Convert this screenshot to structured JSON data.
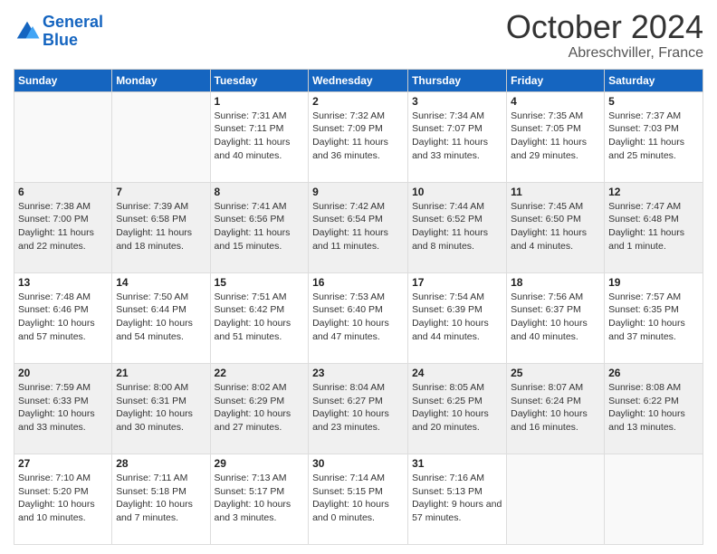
{
  "header": {
    "logo_line1": "General",
    "logo_line2": "Blue",
    "month": "October 2024",
    "location": "Abreschviller, France"
  },
  "days_of_week": [
    "Sunday",
    "Monday",
    "Tuesday",
    "Wednesday",
    "Thursday",
    "Friday",
    "Saturday"
  ],
  "weeks": [
    [
      {
        "day": "",
        "info": ""
      },
      {
        "day": "",
        "info": ""
      },
      {
        "day": "1",
        "info": "Sunrise: 7:31 AM\nSunset: 7:11 PM\nDaylight: 11 hours and 40 minutes."
      },
      {
        "day": "2",
        "info": "Sunrise: 7:32 AM\nSunset: 7:09 PM\nDaylight: 11 hours and 36 minutes."
      },
      {
        "day": "3",
        "info": "Sunrise: 7:34 AM\nSunset: 7:07 PM\nDaylight: 11 hours and 33 minutes."
      },
      {
        "day": "4",
        "info": "Sunrise: 7:35 AM\nSunset: 7:05 PM\nDaylight: 11 hours and 29 minutes."
      },
      {
        "day": "5",
        "info": "Sunrise: 7:37 AM\nSunset: 7:03 PM\nDaylight: 11 hours and 25 minutes."
      }
    ],
    [
      {
        "day": "6",
        "info": "Sunrise: 7:38 AM\nSunset: 7:00 PM\nDaylight: 11 hours and 22 minutes."
      },
      {
        "day": "7",
        "info": "Sunrise: 7:39 AM\nSunset: 6:58 PM\nDaylight: 11 hours and 18 minutes."
      },
      {
        "day": "8",
        "info": "Sunrise: 7:41 AM\nSunset: 6:56 PM\nDaylight: 11 hours and 15 minutes."
      },
      {
        "day": "9",
        "info": "Sunrise: 7:42 AM\nSunset: 6:54 PM\nDaylight: 11 hours and 11 minutes."
      },
      {
        "day": "10",
        "info": "Sunrise: 7:44 AM\nSunset: 6:52 PM\nDaylight: 11 hours and 8 minutes."
      },
      {
        "day": "11",
        "info": "Sunrise: 7:45 AM\nSunset: 6:50 PM\nDaylight: 11 hours and 4 minutes."
      },
      {
        "day": "12",
        "info": "Sunrise: 7:47 AM\nSunset: 6:48 PM\nDaylight: 11 hours and 1 minute."
      }
    ],
    [
      {
        "day": "13",
        "info": "Sunrise: 7:48 AM\nSunset: 6:46 PM\nDaylight: 10 hours and 57 minutes."
      },
      {
        "day": "14",
        "info": "Sunrise: 7:50 AM\nSunset: 6:44 PM\nDaylight: 10 hours and 54 minutes."
      },
      {
        "day": "15",
        "info": "Sunrise: 7:51 AM\nSunset: 6:42 PM\nDaylight: 10 hours and 51 minutes."
      },
      {
        "day": "16",
        "info": "Sunrise: 7:53 AM\nSunset: 6:40 PM\nDaylight: 10 hours and 47 minutes."
      },
      {
        "day": "17",
        "info": "Sunrise: 7:54 AM\nSunset: 6:39 PM\nDaylight: 10 hours and 44 minutes."
      },
      {
        "day": "18",
        "info": "Sunrise: 7:56 AM\nSunset: 6:37 PM\nDaylight: 10 hours and 40 minutes."
      },
      {
        "day": "19",
        "info": "Sunrise: 7:57 AM\nSunset: 6:35 PM\nDaylight: 10 hours and 37 minutes."
      }
    ],
    [
      {
        "day": "20",
        "info": "Sunrise: 7:59 AM\nSunset: 6:33 PM\nDaylight: 10 hours and 33 minutes."
      },
      {
        "day": "21",
        "info": "Sunrise: 8:00 AM\nSunset: 6:31 PM\nDaylight: 10 hours and 30 minutes."
      },
      {
        "day": "22",
        "info": "Sunrise: 8:02 AM\nSunset: 6:29 PM\nDaylight: 10 hours and 27 minutes."
      },
      {
        "day": "23",
        "info": "Sunrise: 8:04 AM\nSunset: 6:27 PM\nDaylight: 10 hours and 23 minutes."
      },
      {
        "day": "24",
        "info": "Sunrise: 8:05 AM\nSunset: 6:25 PM\nDaylight: 10 hours and 20 minutes."
      },
      {
        "day": "25",
        "info": "Sunrise: 8:07 AM\nSunset: 6:24 PM\nDaylight: 10 hours and 16 minutes."
      },
      {
        "day": "26",
        "info": "Sunrise: 8:08 AM\nSunset: 6:22 PM\nDaylight: 10 hours and 13 minutes."
      }
    ],
    [
      {
        "day": "27",
        "info": "Sunrise: 7:10 AM\nSunset: 5:20 PM\nDaylight: 10 hours and 10 minutes."
      },
      {
        "day": "28",
        "info": "Sunrise: 7:11 AM\nSunset: 5:18 PM\nDaylight: 10 hours and 7 minutes."
      },
      {
        "day": "29",
        "info": "Sunrise: 7:13 AM\nSunset: 5:17 PM\nDaylight: 10 hours and 3 minutes."
      },
      {
        "day": "30",
        "info": "Sunrise: 7:14 AM\nSunset: 5:15 PM\nDaylight: 10 hours and 0 minutes."
      },
      {
        "day": "31",
        "info": "Sunrise: 7:16 AM\nSunset: 5:13 PM\nDaylight: 9 hours and 57 minutes."
      },
      {
        "day": "",
        "info": ""
      },
      {
        "day": "",
        "info": ""
      }
    ]
  ]
}
